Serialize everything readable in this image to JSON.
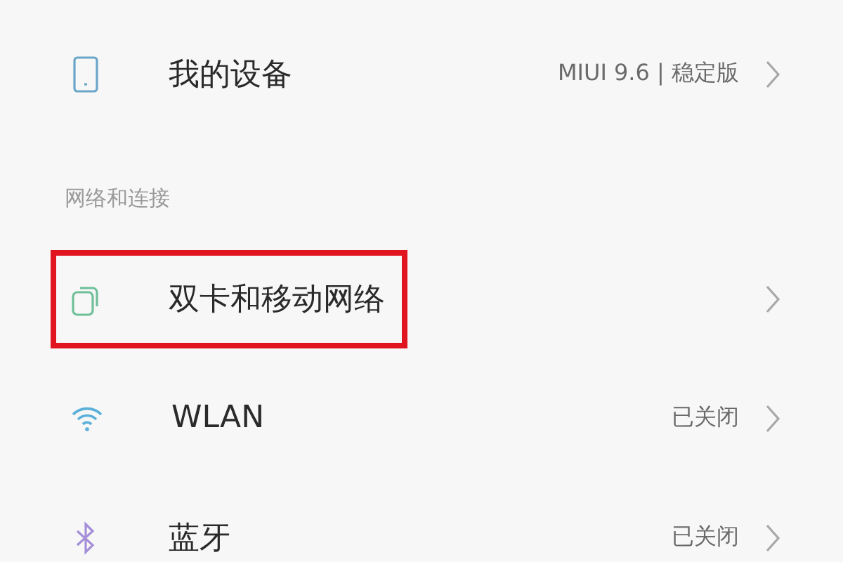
{
  "sections": [
    {
      "items": [
        {
          "kind": "phone",
          "label": "我的设备",
          "value": "MIUI 9.6 | 稳定版",
          "highlighted": false
        }
      ]
    },
    {
      "header": "网络和连接",
      "items": [
        {
          "kind": "sim",
          "label": "双卡和移动网络",
          "highlighted": true
        },
        {
          "kind": "wifi",
          "label": "WLAN",
          "value": "已关闭",
          "highlighted": false
        },
        {
          "kind": "bluetooth",
          "label": "蓝牙",
          "value": "已关闭",
          "highlighted": false
        }
      ]
    }
  ]
}
